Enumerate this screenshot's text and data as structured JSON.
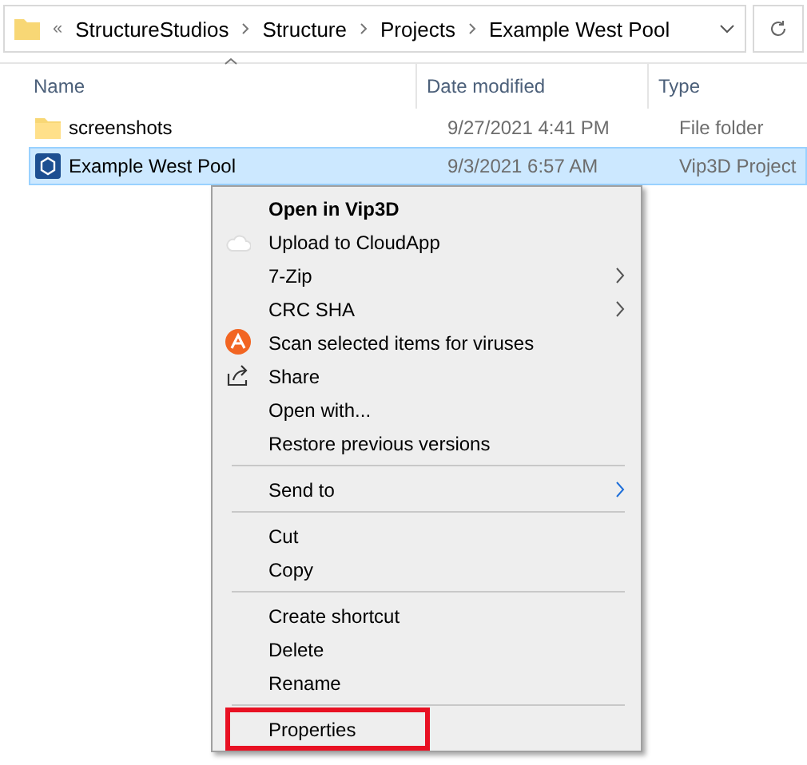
{
  "address_bar": {
    "overflow": "«",
    "crumbs": [
      "StructureStudios",
      "Structure",
      "Projects",
      "Example West Pool"
    ]
  },
  "columns": [
    {
      "label": "Name",
      "sorted": true
    },
    {
      "label": "Date modified",
      "sorted": false
    },
    {
      "label": "Type",
      "sorted": false
    }
  ],
  "rows": [
    {
      "kind": "folder",
      "name": "screenshots",
      "date": "9/27/2021 4:41 PM",
      "type": "File folder",
      "selected": false
    },
    {
      "kind": "file",
      "name": "Example West Pool",
      "date": "9/3/2021 6:57 AM",
      "type": "Vip3D Project",
      "selected": true
    }
  ],
  "context_menu": [
    {
      "kind": "plain",
      "label": "Open in Vip3D",
      "bold": true
    },
    {
      "kind": "cloud",
      "label": "Upload to CloudApp"
    },
    {
      "kind": "plain",
      "label": "7-Zip",
      "submenu": true
    },
    {
      "kind": "plain",
      "label": "CRC SHA",
      "submenu": true
    },
    {
      "kind": "antivirus",
      "label": "Scan selected items for viruses"
    },
    {
      "kind": "share",
      "label": "Share"
    },
    {
      "kind": "plain",
      "label": "Open with..."
    },
    {
      "kind": "plain",
      "label": "Restore previous versions"
    },
    {
      "kind": "separator"
    },
    {
      "kind": "plain",
      "label": "Send to",
      "submenu": true
    },
    {
      "kind": "separator"
    },
    {
      "kind": "plain",
      "label": "Cut"
    },
    {
      "kind": "plain",
      "label": "Copy"
    },
    {
      "kind": "separator"
    },
    {
      "kind": "plain",
      "label": "Create shortcut"
    },
    {
      "kind": "plain",
      "label": "Delete"
    },
    {
      "kind": "plain",
      "label": "Rename"
    },
    {
      "kind": "separator"
    },
    {
      "kind": "plain",
      "label": "Properties",
      "highlighted": true
    }
  ]
}
